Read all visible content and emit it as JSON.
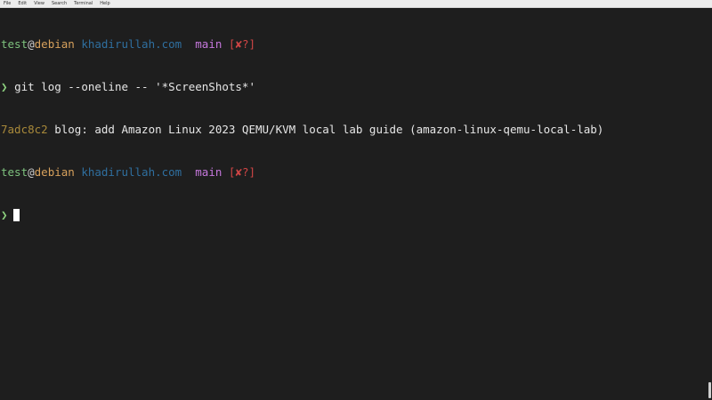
{
  "menubar": {
    "items": [
      "File",
      "Edit",
      "View",
      "Search",
      "Terminal",
      "Help"
    ]
  },
  "prompt": {
    "user": "test",
    "at": "@",
    "host": "debian",
    "domain": "khadirullah.com",
    "branch": "main",
    "status": "[✘?]",
    "arrow": "❯"
  },
  "command": "git log --oneline -- '*ScreenShots*'",
  "output": {
    "hash": "7adc8c2",
    "message": "blog: add Amazon Linux 2023 QEMU/KVM local lab guide (amazon-linux-qemu-local-lab)"
  },
  "colors": {
    "background": "#1e1e1e",
    "user": "#7ec27e",
    "host": "#d7a15c",
    "domain": "#2f6f9f",
    "branch": "#c678dd",
    "status": "#d04545",
    "hash": "#a8893a"
  }
}
